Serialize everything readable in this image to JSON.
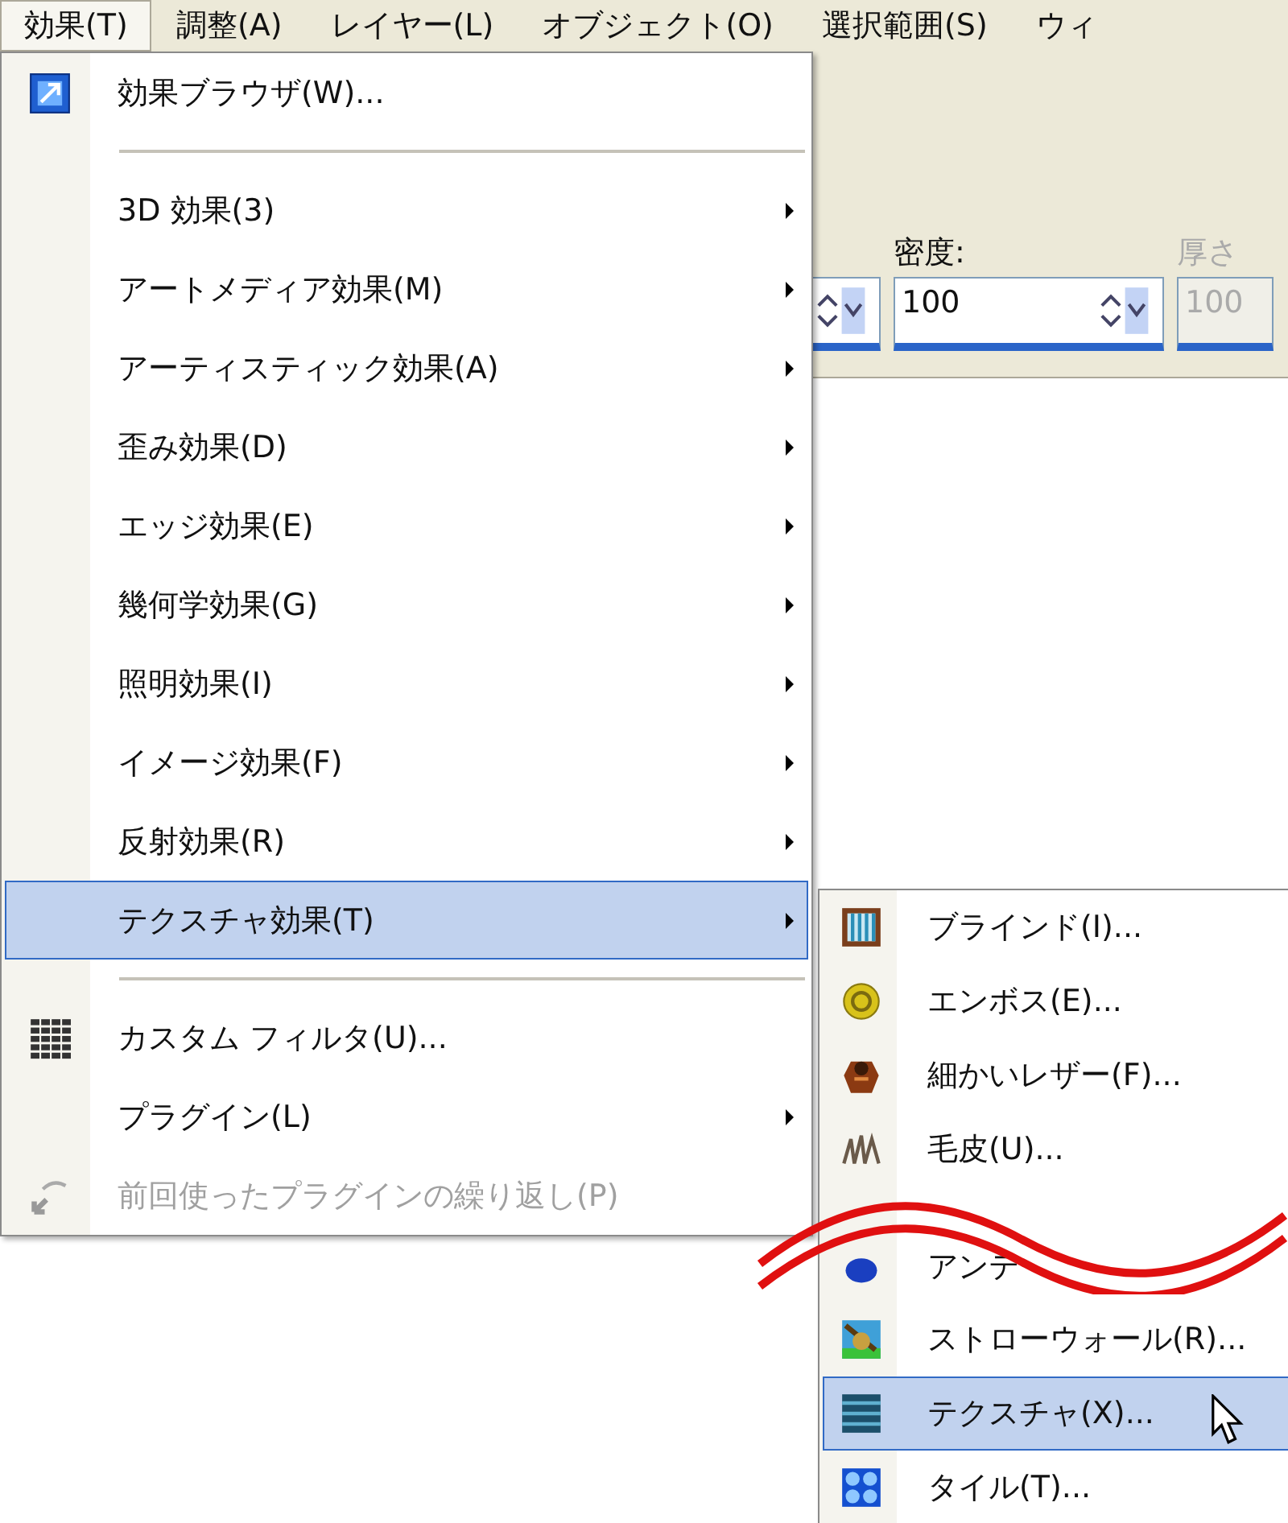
{
  "menubar": [
    {
      "label": "効果(T)",
      "selected": true
    },
    {
      "label": "調整(A)",
      "selected": false
    },
    {
      "label": "レイヤー(L)",
      "selected": false
    },
    {
      "label": "オブジェクト(O)",
      "selected": false
    },
    {
      "label": "選択範囲(S)",
      "selected": false
    },
    {
      "label": "ウィ",
      "selected": false
    }
  ],
  "toolbar": {
    "fields": [
      {
        "label": "密度:",
        "value": "100",
        "disabled": false
      },
      {
        "label": "厚さ",
        "value": "100",
        "disabled": true
      }
    ]
  },
  "effects_menu": {
    "items": [
      {
        "kind": "item",
        "label": "効果ブラウザ(W)...",
        "submenu": false,
        "selected": false,
        "disabled": false
      },
      {
        "kind": "separator"
      },
      {
        "kind": "item",
        "label": "3D 効果(3)",
        "submenu": true,
        "selected": false,
        "disabled": false
      },
      {
        "kind": "item",
        "label": "アートメディア効果(M)",
        "submenu": true,
        "selected": false,
        "disabled": false
      },
      {
        "kind": "item",
        "label": "アーティスティック効果(A)",
        "submenu": true,
        "selected": false,
        "disabled": false
      },
      {
        "kind": "item",
        "label": "歪み効果(D)",
        "submenu": true,
        "selected": false,
        "disabled": false
      },
      {
        "kind": "item",
        "label": "エッジ効果(E)",
        "submenu": true,
        "selected": false,
        "disabled": false
      },
      {
        "kind": "item",
        "label": "幾何学効果(G)",
        "submenu": true,
        "selected": false,
        "disabled": false
      },
      {
        "kind": "item",
        "label": "照明効果(I)",
        "submenu": true,
        "selected": false,
        "disabled": false
      },
      {
        "kind": "item",
        "label": "イメージ効果(F)",
        "submenu": true,
        "selected": false,
        "disabled": false
      },
      {
        "kind": "item",
        "label": "反射効果(R)",
        "submenu": true,
        "selected": false,
        "disabled": false
      },
      {
        "kind": "item",
        "label": "テクスチャ効果(T)",
        "submenu": true,
        "selected": true,
        "disabled": false
      },
      {
        "kind": "separator"
      },
      {
        "kind": "item",
        "label": "カスタム フィルタ(U)...",
        "submenu": false,
        "selected": false,
        "disabled": false
      },
      {
        "kind": "item",
        "label": "プラグイン(L)",
        "submenu": true,
        "selected": false,
        "disabled": false
      },
      {
        "kind": "item",
        "label": "前回使ったプラグインの繰り返し(P)",
        "submenu": false,
        "selected": false,
        "disabled": true
      }
    ]
  },
  "texture_submenu": {
    "items": [
      {
        "label": "ブラインド(I)...",
        "selected": false
      },
      {
        "label": "エンボス(E)...",
        "selected": false
      },
      {
        "label": "細かいレザー(F)...",
        "selected": false
      },
      {
        "label": "毛皮(U)...",
        "selected": false
      },
      {
        "label": "アンテ",
        "selected": false
      },
      {
        "label": "ストローウォール(R)...",
        "selected": false
      },
      {
        "label": "テクスチャ(X)...",
        "selected": true
      },
      {
        "label": "タイル(T)...",
        "selected": false
      }
    ]
  }
}
